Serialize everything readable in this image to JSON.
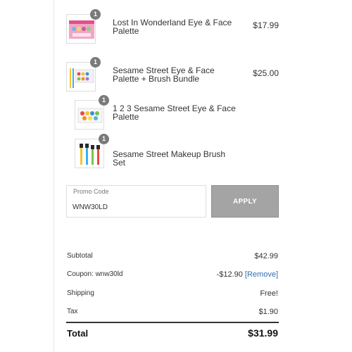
{
  "cart": {
    "items": [
      {
        "name": "Lost In Wonderland Eye & Face Palette",
        "price": "$17.99",
        "qty": "1"
      },
      {
        "name": "Sesame Street Eye & Face Palette + Brush Bundle",
        "price": "$25.00",
        "qty": "1"
      },
      {
        "name": "1 2 3 Sesame Street Eye & Face Palette",
        "price": "",
        "qty": "1"
      },
      {
        "name": "Sesame Street Makeup Brush Set",
        "price": "",
        "qty": "1"
      }
    ]
  },
  "promo": {
    "label": "Promo Code",
    "value": "WNW30LD",
    "apply_label": "APPLY"
  },
  "summary": {
    "subtotal_label": "Subtotal",
    "subtotal_value": "$42.99",
    "coupon_label": "Coupon: wnw30ld",
    "coupon_value": "-$12.90",
    "coupon_remove": "[Remove]",
    "shipping_label": "Shipping",
    "shipping_value": "Free!",
    "tax_label": "Tax",
    "tax_value": "$1.90",
    "total_label": "Total",
    "total_value": "$31.99"
  },
  "colors": {
    "apply_button": "#a4a4a4",
    "link": "#2f6fb0",
    "badge": "#7a7a7a"
  },
  "icons": [
    "wonderland-palette-thumbnail",
    "sesame-bundle-thumbnail",
    "sesame-palette-thumbnail",
    "brush-set-thumbnail"
  ]
}
